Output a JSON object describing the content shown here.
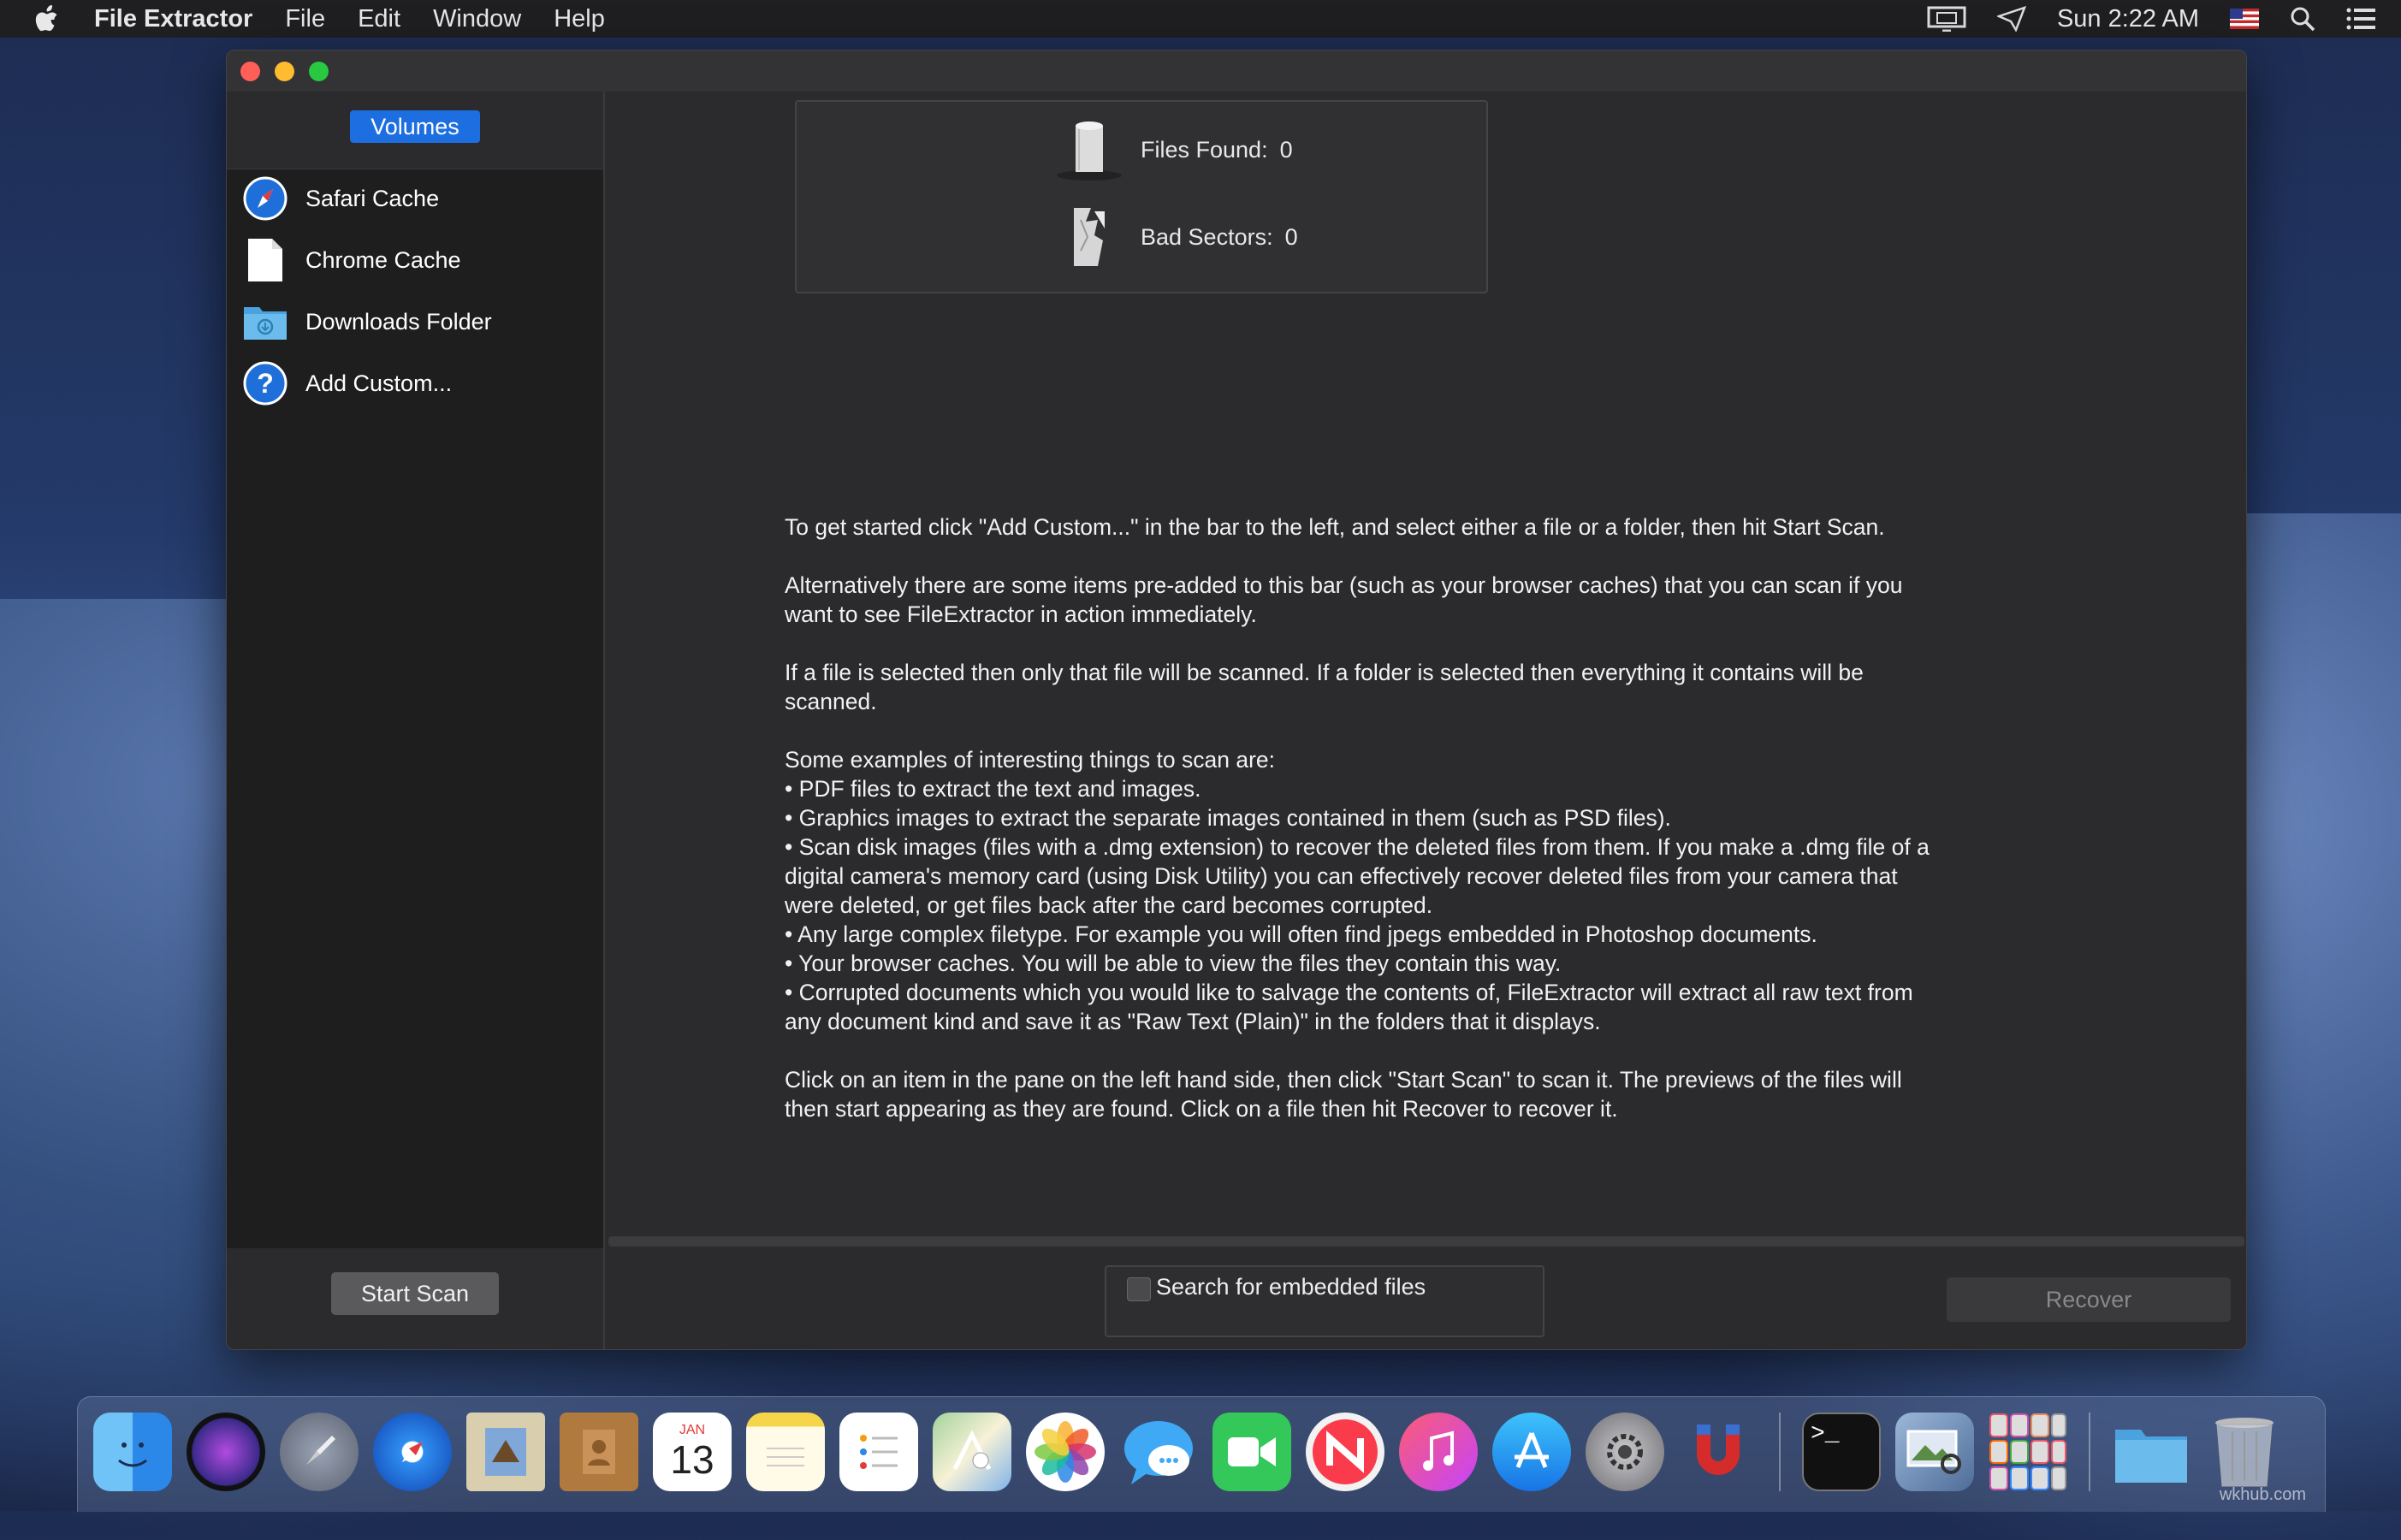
{
  "menubar": {
    "app": "File Extractor",
    "items": [
      "File",
      "Edit",
      "Window",
      "Help"
    ],
    "clock": "Sun 2:22 AM"
  },
  "sidebar": {
    "tab": "Volumes",
    "items": [
      {
        "label": "Safari Cache",
        "icon": "compass-icon"
      },
      {
        "label": "Chrome Cache",
        "icon": "document-icon"
      },
      {
        "label": "Downloads Folder",
        "icon": "folder-icon"
      },
      {
        "label": "Add Custom...",
        "icon": "help-icon"
      }
    ],
    "start_scan": "Start Scan"
  },
  "stats": {
    "files_found_label": "Files Found:",
    "files_found": "0",
    "bad_sectors_label": "Bad Sectors:",
    "bad_sectors": "0"
  },
  "info": {
    "p1": "To get started click \"Add Custom...\" in the bar to the left, and select either a file or a folder, then hit Start Scan.",
    "p2": "Alternatively there are some items pre-added to this bar (such as your browser caches) that you can scan if you want to see FileExtractor in action immediately.",
    "p3": "If a file is selected then only that file will be scanned. If a folder is selected then everything it contains will be scanned.",
    "examples_title": "Some examples of interesting things to scan are:",
    "examples": [
      "• PDF files to extract the text and images.",
      "• Graphics images to extract the separate images contained in them (such as PSD files).",
      "• Scan disk images (files with a .dmg extension) to recover the deleted files from them. If you make a .dmg file of a digital camera's memory card (using Disk Utility) you can effectively recover deleted files from your camera that were deleted, or get files back after the card becomes corrupted.",
      "• Any large complex filetype. For example you will often find jpegs embedded in Photoshop documents.",
      "• Your browser caches. You will be able to view the files they contain this way.",
      "• Corrupted documents which you would like to salvage the contents of, FileExtractor will extract all raw text from any document kind and save it as \"Raw Text (Plain)\" in the folders that it displays."
    ],
    "p5": "Click on an item in the pane on the left hand side, then click \"Start Scan\" to scan it. The previews of the files will then start appearing as they are found. Click on a file then hit Recover to recover it."
  },
  "bottom": {
    "embedded_label": "Search for embedded files",
    "recover": "Recover"
  },
  "dock": {
    "calendar_month": "JAN",
    "calendar_day": "13",
    "terminal_prompt": ">_",
    "watermark": "wkhub.com"
  }
}
